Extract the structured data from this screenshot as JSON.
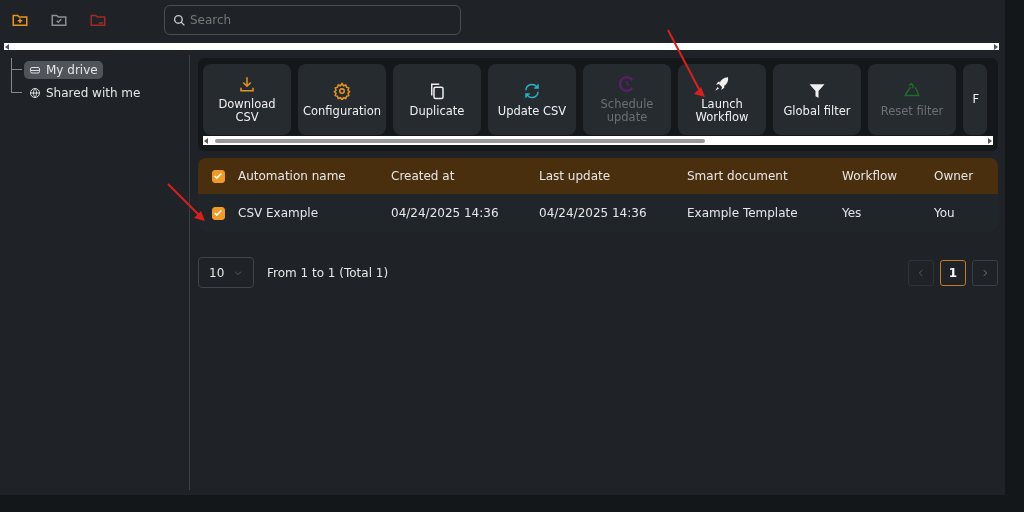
{
  "top_icons": [
    {
      "kind": "folder-add",
      "color": "#e8951e"
    },
    {
      "kind": "folder-check",
      "color": "#8a9096"
    },
    {
      "kind": "folder-remove",
      "color": "#a3282b"
    }
  ],
  "search": {
    "placeholder": "Search"
  },
  "sidebar": {
    "items": [
      {
        "label": "My drive",
        "selected": true
      },
      {
        "label": "Shared with me",
        "selected": false
      }
    ]
  },
  "toolbar": {
    "buttons": [
      {
        "label": "Download CSV",
        "disabled": false
      },
      {
        "label": "Configuration",
        "disabled": false
      },
      {
        "label": "Duplicate",
        "disabled": false
      },
      {
        "label": "Update CSV",
        "disabled": false
      },
      {
        "label": "Schedule update",
        "disabled": true
      },
      {
        "label": "Launch Workflow",
        "disabled": false
      },
      {
        "label": "Global filter",
        "disabled": false
      },
      {
        "label": "Reset filter",
        "disabled": true
      },
      {
        "label": "F",
        "disabled": false
      }
    ]
  },
  "table": {
    "all_checked": true,
    "columns": [
      "Automation name",
      "Created at",
      "Last update",
      "Smart document",
      "Workflow",
      "Owner"
    ],
    "rows": [
      {
        "checked": true,
        "cells": [
          "CSV Example",
          "04/24/2025 14:36",
          "04/24/2025 14:36",
          "Example Template",
          "Yes",
          "You"
        ]
      }
    ]
  },
  "pagination": {
    "page_size": "10",
    "summary": "From 1 to 1 (Total 1)",
    "pages": [
      {
        "label": "1",
        "selected": true
      }
    ]
  },
  "annotations": [
    {
      "kind": "arrow"
    },
    {
      "kind": "arrow"
    }
  ]
}
